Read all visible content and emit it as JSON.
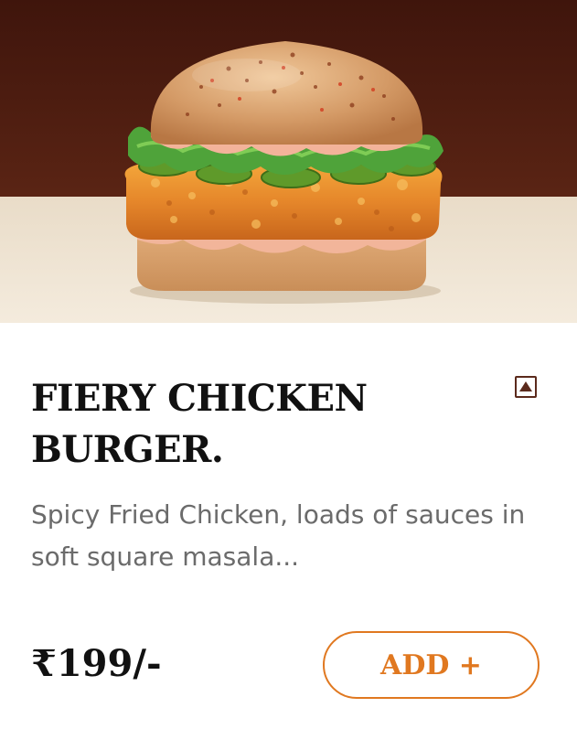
{
  "product": {
    "image_alt": "Fiery Chicken Burger",
    "title": "FIERY CHICKEN BURGER.",
    "diet_icon": "non-veg-triangle-icon",
    "description": "Spicy Fried Chicken, loads of sauces in soft square masala...",
    "price": "₹199/-",
    "add_label": "ADD +"
  },
  "colors": {
    "accent": "#e07820",
    "title": "#111111",
    "description": "#6b6b6b",
    "icon": "#5b2a1c",
    "hero_top": "#4a1a10",
    "hero_bottom": "#efe3d2"
  }
}
